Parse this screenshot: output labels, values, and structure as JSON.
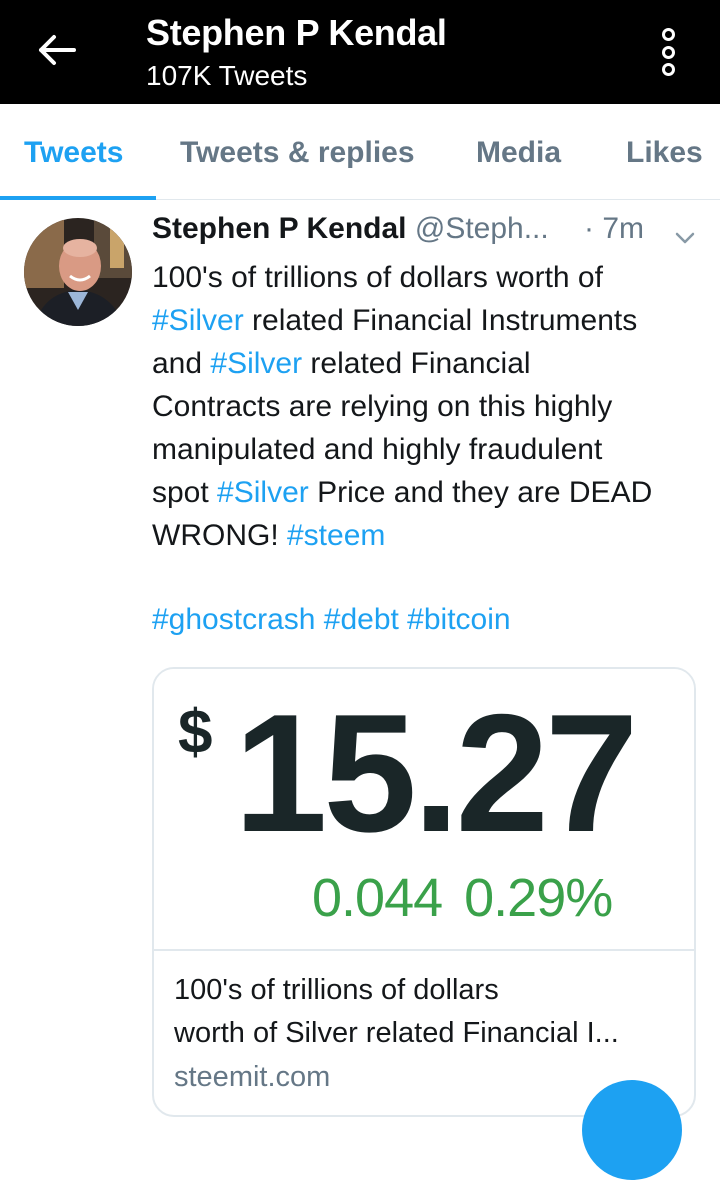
{
  "header": {
    "title": "Stephen P Kendal",
    "subtitle": "107K Tweets"
  },
  "tabs": [
    {
      "label": "Tweets",
      "active": true
    },
    {
      "label": "Tweets & replies",
      "active": false
    },
    {
      "label": "Media",
      "active": false
    },
    {
      "label": "Likes",
      "active": false
    }
  ],
  "tweet": {
    "author_name": "Stephen P Kendal",
    "author_handle": "@Steph...",
    "time": "· 7m",
    "lines": [
      {
        "parts": [
          "100's of trillions of dollars worth of"
        ]
      },
      {
        "tag": "#Silver",
        "rest": " related Financial Instruments"
      },
      {
        "pre": "and ",
        "tag": "#Silver",
        "rest": " related Financial"
      },
      {
        "text": "Contracts are relying on this highly"
      },
      {
        "text": "manipulated and highly fraudulent"
      },
      {
        "pre": "spot ",
        "tag": "#Silver",
        "rest": " Price and they are DEAD"
      },
      {
        "pre": "WRONG! ",
        "tag": "#steem"
      }
    ],
    "hashtags_line": "#ghostcrash #debt #bitcoin"
  },
  "card": {
    "currency": "$",
    "price": "15.27",
    "change": "0.044",
    "change_pct": "0.29%",
    "title_line1": "100's of trillions of dollars",
    "title_line2": "worth of Silver related Financial I...",
    "domain": "steemit.com"
  },
  "colors": {
    "accent": "#1da1f2",
    "topbar": "#000000",
    "price_up": "#3aa14a"
  },
  "icons": {
    "back": "arrow-left-icon",
    "more": "vertical-dots-icon",
    "caret": "chevron-down-icon"
  }
}
